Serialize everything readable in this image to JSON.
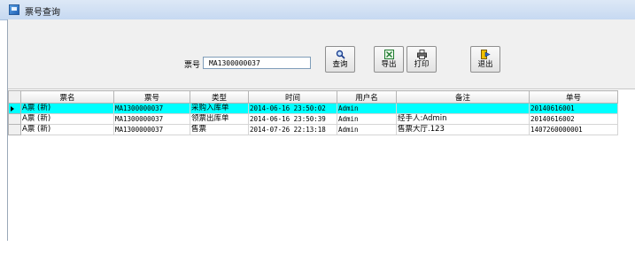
{
  "window": {
    "title": "票号查询"
  },
  "search": {
    "label": "票号",
    "value": "MA1300000037"
  },
  "toolbar": {
    "query_label": "查询",
    "export_label": "导出",
    "print_label": "打印",
    "exit_label": "退出"
  },
  "colors": {
    "selected_row": "#00ffff",
    "titlebar": "#c6d9f1"
  },
  "table": {
    "columns": [
      "票名",
      "票号",
      "类型",
      "时间",
      "用户名",
      "备注",
      "单号"
    ],
    "rows": [
      [
        "A票 (新)",
        "MA1300000037",
        "采购入库单",
        "2014-06-16 23:50:02",
        "Admin",
        "",
        "20140616001"
      ],
      [
        "A票 (新)",
        "MA1300000037",
        "领票出库单",
        "2014-06-16 23:50:39",
        "Admin",
        "经手人:Admin",
        "20140616002"
      ],
      [
        "A票 (新)",
        "MA1300000037",
        "售票",
        "2014-07-26 22:13:18",
        "Admin",
        "售票大厅.123",
        "1407260000001"
      ]
    ]
  }
}
